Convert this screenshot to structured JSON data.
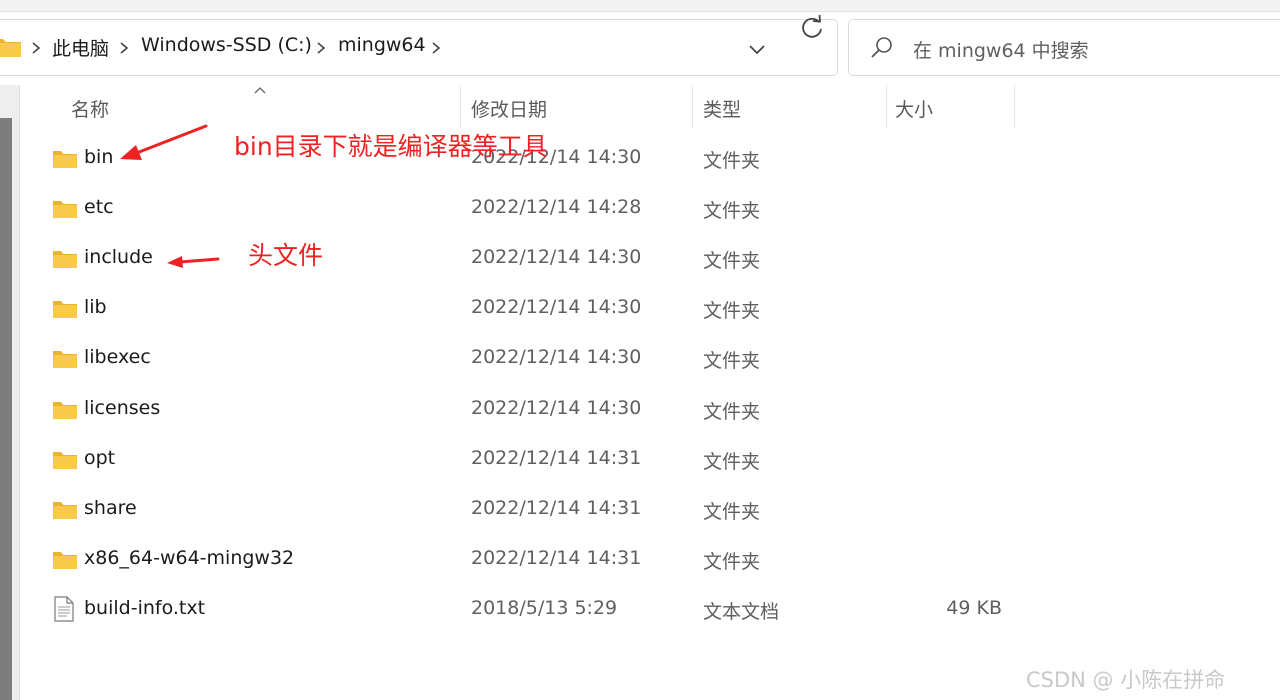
{
  "address": {
    "crumbs": [
      "此电脑",
      "Windows-SSD (C:)",
      "mingw64"
    ]
  },
  "search": {
    "placeholder": "在 mingw64 中搜索"
  },
  "columns": {
    "name": "名称",
    "modified": "修改日期",
    "type": "类型",
    "size": "大小"
  },
  "files": [
    {
      "name": "bin",
      "modified": "2022/12/14 14:30",
      "type": "文件夹",
      "size": "",
      "icon": "folder-icon"
    },
    {
      "name": "etc",
      "modified": "2022/12/14 14:28",
      "type": "文件夹",
      "size": "",
      "icon": "folder-icon"
    },
    {
      "name": "include",
      "modified": "2022/12/14 14:30",
      "type": "文件夹",
      "size": "",
      "icon": "folder-icon"
    },
    {
      "name": "lib",
      "modified": "2022/12/14 14:30",
      "type": "文件夹",
      "size": "",
      "icon": "folder-icon"
    },
    {
      "name": "libexec",
      "modified": "2022/12/14 14:30",
      "type": "文件夹",
      "size": "",
      "icon": "folder-icon"
    },
    {
      "name": "licenses",
      "modified": "2022/12/14 14:30",
      "type": "文件夹",
      "size": "",
      "icon": "folder-icon"
    },
    {
      "name": "opt",
      "modified": "2022/12/14 14:31",
      "type": "文件夹",
      "size": "",
      "icon": "folder-icon"
    },
    {
      "name": "share",
      "modified": "2022/12/14 14:31",
      "type": "文件夹",
      "size": "",
      "icon": "folder-icon"
    },
    {
      "name": "x86_64-w64-mingw32",
      "modified": "2022/12/14 14:31",
      "type": "文件夹",
      "size": "",
      "icon": "folder-icon"
    },
    {
      "name": "build-info.txt",
      "modified": "2018/5/13 5:29",
      "type": "文本文档",
      "size": "49 KB",
      "icon": "text-file-icon"
    }
  ],
  "annotations": {
    "bin_note": "bin目录下就是编译器等工具",
    "include_note": "头文件"
  },
  "watermark": "CSDN @ 小陈在拼命",
  "colors": {
    "annotation": "#ee2222",
    "folder": "#f8c94a",
    "folder_dark": "#e9b530"
  }
}
